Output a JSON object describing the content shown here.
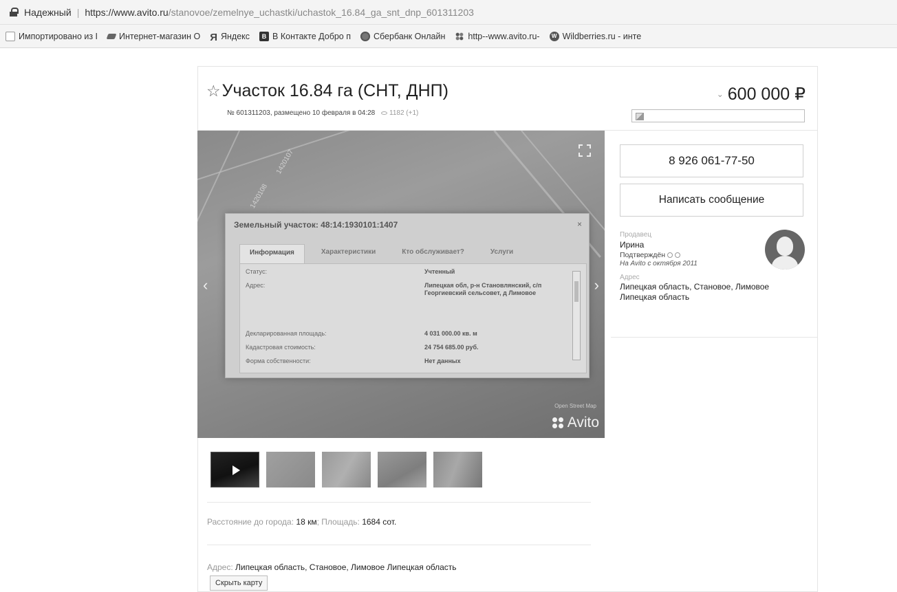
{
  "browser": {
    "secure_label": "Надежный",
    "url_host": "https://www.avito.ru",
    "url_path": "/stanovoe/zemelnye_uchastki/uchastok_16.84_ga_snt_dnp_601311203",
    "bookmarks": [
      {
        "icon": "folder-icon",
        "label": "Импортировано из I"
      },
      {
        "icon": "shop-icon",
        "label": "Интернет-магазин О"
      },
      {
        "icon": "yandex-icon",
        "label": "Яндекс"
      },
      {
        "icon": "vk-icon",
        "label": "В Контакте Добро п"
      },
      {
        "icon": "sberbank-icon",
        "label": "Сбербанк Онлайн"
      },
      {
        "icon": "avito-icon",
        "label": "http--www.avito.ru-"
      },
      {
        "icon": "wildberries-icon",
        "label": "Wildberries.ru - инте"
      }
    ]
  },
  "listing": {
    "title": "Участок 16.84 га (СНТ, ДНП)",
    "meta": "№ 601311203, размещено 10 февраля в 04:28",
    "views": "1182 (+1)",
    "price": "600 000 ₽",
    "price_chevron": "⌄"
  },
  "photo": {
    "dialog_title": "Земельный участок: 48:14:1930101:1407",
    "dialog_close": "×",
    "tabs": [
      "Информация",
      "Характеристики",
      "Кто обслуживает?",
      "Услуги"
    ],
    "rows": [
      {
        "label": "Статус:",
        "value": "Учтенный"
      },
      {
        "label": "Адрес:",
        "value": "Липецкая обл, р-н Становлянский, с/п Георгиевский сельсовет, д Лимовое"
      },
      {
        "label": "Декларированная площадь:",
        "value": "4 031 000.00 кв. м"
      },
      {
        "label": "Кадастровая стоимость:",
        "value": "24 754 685.00 руб."
      },
      {
        "label": "Форма собственности:",
        "value": "Нет данных"
      }
    ],
    "map_labels": [
      "1420107",
      "1420108"
    ],
    "caption": "Open Street Map",
    "logo": "Avito",
    "arrow_left": "‹",
    "arrow_right": "›"
  },
  "thumbnails": [
    "video",
    "photo",
    "photo",
    "photo",
    "photo"
  ],
  "params": {
    "distance_label": "Расстояние до города:",
    "distance_value": "18 км",
    "area_label": "Площадь:",
    "area_value": "1684 сот."
  },
  "address": {
    "label": "Адрес:",
    "value": "Липецкая область, Становое, Лимовое Липецкая область",
    "hide_map": "Скрыть карту"
  },
  "sidebar": {
    "phone": "8 926 061-77-50",
    "message": "Написать сообщение",
    "seller_label": "Продавец",
    "seller_name": "Ирина",
    "verified": "Подтверждён",
    "since": "На Avito с октября 2011",
    "address_label": "Адрес",
    "address": "Липецкая область, Становое, Лимовое Липецкая область"
  }
}
